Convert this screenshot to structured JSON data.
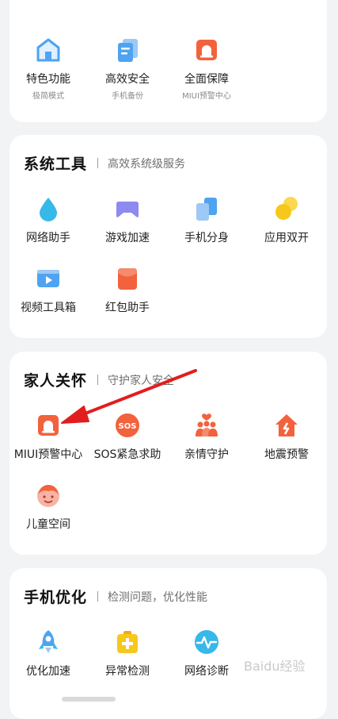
{
  "top": {
    "items": [
      {
        "label": "特色功能",
        "sub": "极简模式",
        "icon": "house-icon"
      },
      {
        "label": "高效安全",
        "sub": "手机备份",
        "icon": "documents-icon"
      },
      {
        "label": "全面保障",
        "sub": "MIUI预警中心",
        "icon": "alarm-icon"
      }
    ]
  },
  "system_tools": {
    "title": "系统工具",
    "subtitle": "高效系统级服务",
    "items": [
      {
        "label": "网络助手",
        "icon": "droplet-icon"
      },
      {
        "label": "游戏加速",
        "icon": "gamepad-icon"
      },
      {
        "label": "手机分身",
        "icon": "dual-phone-icon"
      },
      {
        "label": "应用双开",
        "icon": "dual-circles-icon"
      },
      {
        "label": "视频工具箱",
        "icon": "video-icon"
      },
      {
        "label": "红包助手",
        "icon": "red-packet-icon"
      }
    ]
  },
  "family_care": {
    "title": "家人关怀",
    "subtitle": "守护家人安全",
    "items": [
      {
        "label": "MIUI预警中心",
        "icon": "alarm-icon"
      },
      {
        "label": "SOS紧急求助",
        "icon": "sos-icon",
        "icon_text": "SOS"
      },
      {
        "label": "亲情守护",
        "icon": "family-icon"
      },
      {
        "label": "地震预警",
        "icon": "earthquake-icon"
      },
      {
        "label": "儿童空间",
        "icon": "child-face-icon"
      }
    ]
  },
  "phone_optimize": {
    "title": "手机优化",
    "subtitle": "检测问题，优化性能",
    "items": [
      {
        "label": "优化加速",
        "icon": "rocket-icon"
      },
      {
        "label": "异常检测",
        "icon": "first-aid-icon"
      },
      {
        "label": "网络诊断",
        "icon": "pulse-icon"
      }
    ]
  },
  "watermark": "Baidu经验",
  "colors": {
    "blue": "#4fa3f0",
    "purple": "#8d8af0",
    "yellow": "#f7c81c",
    "orange": "#f2623d",
    "red": "#f04b3a",
    "teal": "#36b8e8",
    "background": "#f2f3f5",
    "card": "#ffffff",
    "arrow": "#e21d1d"
  }
}
